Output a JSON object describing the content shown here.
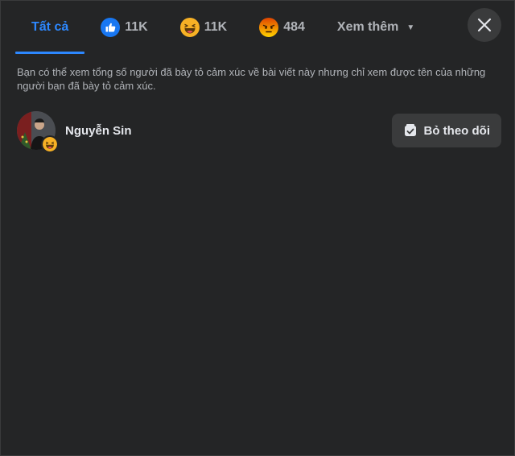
{
  "tabs": [
    {
      "label": "Tất cả",
      "icon": "",
      "active": true
    },
    {
      "label": "11K",
      "icon": "like-reaction-icon"
    },
    {
      "label": "11K",
      "icon": "haha-reaction-icon"
    },
    {
      "label": "484",
      "icon": "angry-reaction-icon"
    },
    {
      "label": "Xem thêm",
      "icon": "chevron-down-icon"
    }
  ],
  "close_icon": "close-icon",
  "note": "Bạn có thể xem tổng số người đã bày tỏ cảm xúc về bài viết này nhưng chỉ xem được tên của những người bạn đã bày tỏ cảm xúc.",
  "people": [
    {
      "name": "Nguyễn Sin",
      "reaction": "haha-reaction-icon",
      "button_label": "Bỏ theo dõi",
      "button_icon": "unfollow-icon"
    }
  ],
  "colors": {
    "background": "#242526",
    "accent": "#2d88ff",
    "like": "#1877f2",
    "haha": "#f7b125",
    "angry": "#e9710f"
  }
}
